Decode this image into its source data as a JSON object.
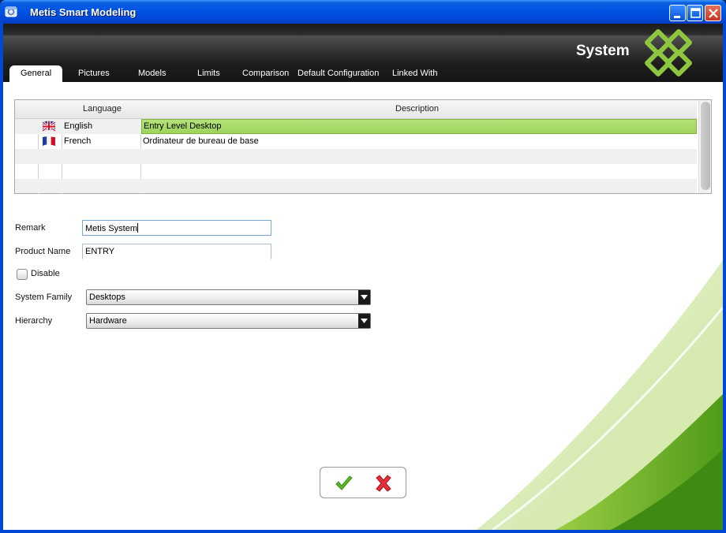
{
  "window": {
    "title": "Metis Smart Modeling",
    "controls": [
      "minimize-icon",
      "maximize-icon",
      "close-icon"
    ]
  },
  "header": {
    "section_title": "System",
    "tabs": [
      {
        "label": "General",
        "active": true
      },
      {
        "label": "Pictures"
      },
      {
        "label": "Models"
      },
      {
        "label": "Limits"
      },
      {
        "label": "Comparison"
      },
      {
        "label": "Default Configuration"
      },
      {
        "label": "Linked With"
      }
    ]
  },
  "languages_table": {
    "columns": [
      "Language",
      "Description"
    ],
    "rows": [
      {
        "flag": "uk-flag-icon",
        "language": "English",
        "description": "Entry Level Desktop",
        "selected": true
      },
      {
        "flag": "france-flag-icon",
        "language": "French",
        "description": "Ordinateur de bureau de base"
      }
    ]
  },
  "form": {
    "remark_label": "Remark",
    "remark_value": "Metis System",
    "product_name_label": "Product Name",
    "product_name_value": "ENTRY",
    "disable_label": "Disable",
    "disable_checked": false,
    "system_family_label": "System Family",
    "system_family_value": "Desktops",
    "hierarchy_label": "Hierarchy",
    "hierarchy_value": "Hardware"
  },
  "actions": {
    "ok_icon": "green-checkmark-icon",
    "cancel_icon": "red-x-icon"
  },
  "colors": {
    "accent_green": "#8ec63f",
    "selection_green": "#a6d86a",
    "header_dark": "#2a2a2a",
    "titlebar_blue": "#0054e3"
  }
}
